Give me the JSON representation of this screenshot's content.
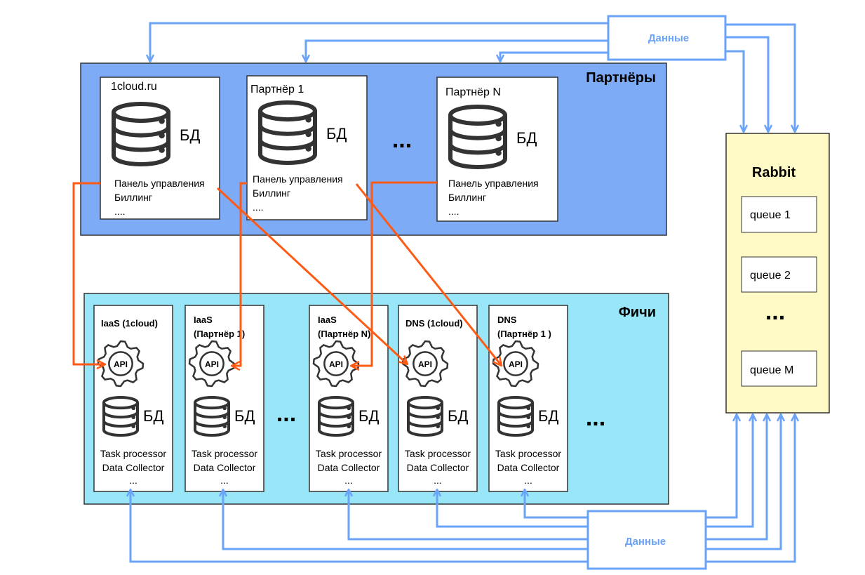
{
  "colors": {
    "partners_bg": "#7eabf5",
    "features_bg": "#99e6f9",
    "rabbit_bg": "#fef9c5",
    "data_line": "#6aa3f8",
    "api_line": "#ff5a14"
  },
  "data_top": {
    "label": "Данные"
  },
  "data_bottom": {
    "label": "Данные"
  },
  "partners": {
    "title": "Партнёры",
    "ellipsis": "...",
    "items": [
      {
        "name": "1cloud.ru",
        "db": "БД",
        "lines": [
          "Панель управления",
          "Биллинг",
          "...."
        ]
      },
      {
        "name": "Партнёр 1",
        "db": "БД",
        "lines": [
          "Панель управления",
          "Биллинг",
          "...."
        ]
      },
      {
        "name": "Партнёр N",
        "db": "БД",
        "lines": [
          "Панель управления",
          "Биллинг",
          "...."
        ]
      }
    ]
  },
  "features": {
    "title": "Фичи",
    "ellipsis": "...",
    "items": [
      {
        "title": [
          "IaaS (1cloud)"
        ],
        "api": "API",
        "db": "БД",
        "lines": [
          "Task processor",
          "Data Collector",
          "..."
        ]
      },
      {
        "title": [
          "IaaS",
          "(Партнёр 1)"
        ],
        "api": "API",
        "db": "БД",
        "lines": [
          "Task processor",
          "Data Collector",
          "..."
        ]
      },
      {
        "title": [
          "IaaS",
          "(Партнёр N)"
        ],
        "api": "API",
        "db": "БД",
        "lines": [
          "Task processor",
          "Data Collector",
          "..."
        ]
      },
      {
        "title": [
          "DNS (1cloud)"
        ],
        "api": "API",
        "db": "БД",
        "lines": [
          "Task processor",
          "Data Collector",
          "..."
        ]
      },
      {
        "title": [
          "DNS",
          "(Партнёр 1 )"
        ],
        "api": "API",
        "db": "БД",
        "lines": [
          "Task processor",
          "Data Collector",
          "..."
        ]
      }
    ]
  },
  "rabbit": {
    "title": "Rabbit",
    "queues": [
      "queue 1",
      "queue 2",
      "queue M"
    ],
    "ellipsis": "..."
  }
}
